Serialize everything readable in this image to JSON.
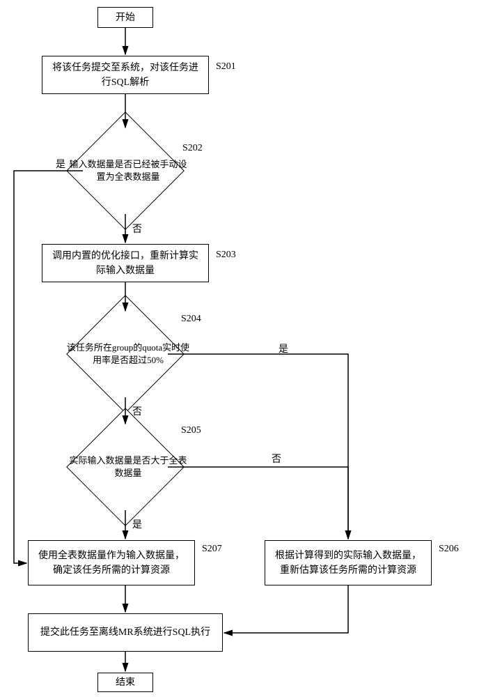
{
  "flow": {
    "start": "开始",
    "end": "结束",
    "s201": {
      "label": "S201",
      "text": "将该任务提交至系统，对该任务进行SQL解析"
    },
    "s202": {
      "label": "S202",
      "text": "输入数据量是否已经被手动设置为全表数据量"
    },
    "s203": {
      "label": "S203",
      "text": "调用内置的优化接口，重新计算实际输入数据量"
    },
    "s204": {
      "label": "S204",
      "text": "该任务所在group的quota实时使用率是否超过50%"
    },
    "s205": {
      "label": "S205",
      "text": "实际输入数据量是否大于全表数据量"
    },
    "s206": {
      "label": "S206",
      "text": "根据计算得到的实际输入数据量，重新估算该任务所需的计算资源"
    },
    "s207": {
      "label": "S207",
      "text": "使用全表数据量作为输入数据量，确定该任务所需的计算资源"
    },
    "submit": "提交此任务至离线MR系统进行SQL执行",
    "yes": "是",
    "no": "否"
  }
}
